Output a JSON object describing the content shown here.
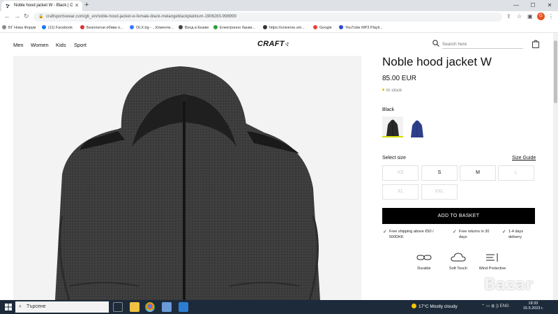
{
  "browser": {
    "tab_title": "Noble hood jacket W - Black | C",
    "url": "craftsportswear.com/gb_en/noble-hood-jacket-w-female-black-melangeblackplatinum-1906283-998999",
    "profile_initial": "G",
    "bookmarks": [
      {
        "label": "БГ Нова Форум",
        "color": "#8a8a8a"
      },
      {
        "label": "(11) Facebook",
        "color": "#1877f2"
      },
      {
        "label": "Безплатни обяви о...",
        "color": "#d33"
      },
      {
        "label": "OLX.bg - ...Клиенти...",
        "color": "#3a77ff"
      },
      {
        "label": "Вход в Екзим",
        "color": "#444"
      },
      {
        "label": "Електронно банки...",
        "color": "#2a9d3a"
      },
      {
        "label": "https://universe.sm...",
        "color": "#333"
      },
      {
        "label": "Google",
        "color": "#ea4335"
      },
      {
        "label": "YouTube MP3 Playli...",
        "color": "#2b4bd6"
      }
    ]
  },
  "site": {
    "nav": [
      "Men",
      "Women",
      "Kids",
      "Sport"
    ],
    "logo": "CRAFT",
    "search_placeholder": "Search here"
  },
  "product": {
    "title": "Noble hood jacket W",
    "price": "85.00 EUR",
    "stock": "In stock",
    "color_label": "Black",
    "swatches": [
      {
        "name": "Black",
        "color": "#2a2a2a"
      },
      {
        "name": "Blue",
        "color": "#2d3f8a"
      }
    ],
    "size_label": "Select size",
    "size_guide": "Size Guide",
    "sizes": [
      {
        "label": "XS",
        "available": false
      },
      {
        "label": "S",
        "available": true
      },
      {
        "label": "M",
        "available": true
      },
      {
        "label": "L",
        "available": false
      },
      {
        "label": "XL",
        "available": false
      },
      {
        "label": "XXL",
        "available": false
      }
    ],
    "add_to_basket": "ADD TO BASKET",
    "usps": [
      {
        "line1": "Free shipping above €50 /",
        "line2": "500DKK"
      },
      {
        "line1": "Free returns in 30",
        "line2": "days"
      },
      {
        "line1": "1-4 days",
        "line2": "delivery"
      }
    ],
    "features": [
      "Durable",
      "Soft Touch",
      "Wind Protective"
    ]
  },
  "taskbar": {
    "search_placeholder": "Търсене",
    "weather": "17°C  Mostly cloudy",
    "language": "ENG",
    "time": "18:33",
    "date": "15.5.2023 г."
  },
  "watermark": "Bazar",
  "colors": {
    "accent_underline": "#d4e000",
    "stock_dot": "#f5b800",
    "taskbar": "#1c2a3a"
  }
}
